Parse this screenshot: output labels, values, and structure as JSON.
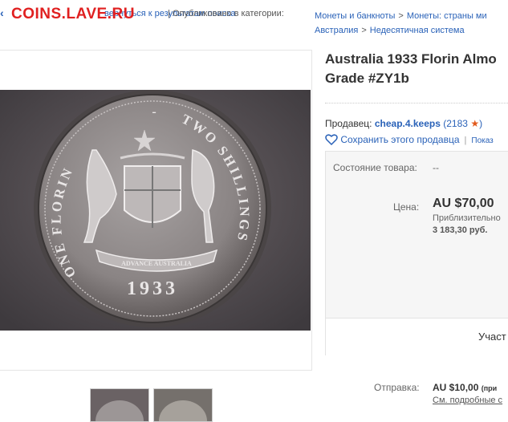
{
  "topbar": {
    "watermark": "COINS.LAVE.RU",
    "back_link": "вернуться к результатам поиска",
    "published_prefix": "Опубликовано в категории:",
    "breadcrumbs": [
      "Монеты и банкноты",
      "Монеты: страны ми",
      "Австралия",
      "Недесятичная система"
    ]
  },
  "listing": {
    "title_line1": "Australia 1933 Florin Almo",
    "title_line2": "Grade #ZY1b",
    "coin_image_alt": "Australia 1933 Florin coin",
    "coin_inscriptions": {
      "left": "ONE FLORIN",
      "dash": "-",
      "right": "TWO SHILLINGS",
      "scroll": "ADVANCE AUSTRALIA",
      "year": "1933"
    }
  },
  "seller": {
    "label": "Продавец:",
    "name": "cheap.4.keeps",
    "feedback_count": "(2183",
    "feedback_close": ")",
    "save_label": "Сохранить этого продавца",
    "more_label": "Показ"
  },
  "offer": {
    "condition_label": "Состояние товара:",
    "condition_value": "--",
    "price_label": "Цена:",
    "price": "AU $70,00",
    "approx_label": "Приблизительно",
    "approx_value": "3 183,30 руб.",
    "action_label": "Участ"
  },
  "shipping": {
    "label": "Отправка:",
    "price": "AU $10,00",
    "note": "(при",
    "details_link": "См. подробные с"
  },
  "colors": {
    "link": "#2a62b8",
    "star": "#e25a1c",
    "watermark": "#e02020"
  }
}
